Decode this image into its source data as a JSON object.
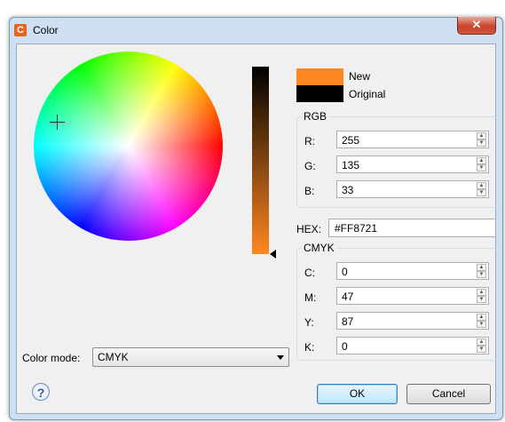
{
  "window": {
    "title": "Color",
    "app_icon_letter": "C",
    "close_glyph": "✕"
  },
  "swatches": {
    "new_label": "New",
    "new_color": "#ff8721",
    "original_label": "Original",
    "original_color": "#000000"
  },
  "rgb": {
    "legend": "RGB",
    "rows": [
      {
        "label": "R:",
        "value": "255"
      },
      {
        "label": "G:",
        "value": "135"
      },
      {
        "label": "B:",
        "value": "33"
      }
    ]
  },
  "hex": {
    "label": "HEX:",
    "value": "#FF8721"
  },
  "cmyk": {
    "legend": "CMYK",
    "rows": [
      {
        "label": "C:",
        "value": "0"
      },
      {
        "label": "M:",
        "value": "47"
      },
      {
        "label": "Y:",
        "value": "87"
      },
      {
        "label": "K:",
        "value": "0"
      }
    ]
  },
  "color_mode": {
    "label": "Color mode:",
    "selected": "CMYK"
  },
  "buttons": {
    "ok": "OK",
    "cancel": "Cancel",
    "help_glyph": "?"
  },
  "icons": {
    "help": "help-icon",
    "close": "close-icon",
    "app": "app-icon",
    "dropdown": "chevron-down-icon"
  }
}
